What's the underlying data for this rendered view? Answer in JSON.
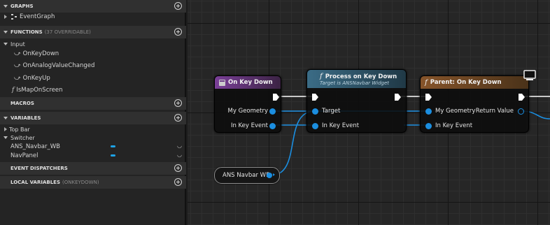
{
  "panel": {
    "graphs": {
      "title": "GRAPHS",
      "items": [
        "EventGraph"
      ]
    },
    "functions": {
      "title": "FUNCTIONS",
      "subtitle": "(37 OVERRIDABLE)",
      "category": "Input",
      "items": [
        "OnKeyDown",
        "OnAnalogValueChanged",
        "OnKeyUp"
      ],
      "extra": "IsMapOnScreen"
    },
    "macros": {
      "title": "MACROS"
    },
    "variables": {
      "title": "VARIABLES",
      "categories": [
        "Top Bar",
        "Switcher"
      ],
      "items": [
        {
          "name": "ANS_Navbar_WB",
          "type_color": "#1ea2e6"
        },
        {
          "name": "NavPanel",
          "type_color": "#1ea2e6"
        }
      ]
    },
    "event_dispatchers": {
      "title": "EVENT DISPATCHERS"
    },
    "local_variables": {
      "title": "LOCAL VARIABLES",
      "subtitle": "(ONKEYDOWN)"
    }
  },
  "graph": {
    "node_on_key_down": {
      "title": "On Key Down",
      "header_color": "#7a3f98",
      "pins": [
        "My Geometry",
        "In Key Event"
      ]
    },
    "node_process": {
      "title": "Process on Key Down",
      "subtitle": "Target is ANSNavbar Widget",
      "header_color": "#3b6c86",
      "pins": [
        "Target",
        "In Key Event"
      ]
    },
    "node_parent": {
      "title": "Parent: On Key Down",
      "header_color": "#86542a",
      "inputs": [
        "My Geometry",
        "In Key Event"
      ],
      "outputs": [
        "Return Value"
      ]
    },
    "var_node": {
      "label": "ANS Navbar WB"
    },
    "colors": {
      "struct_pin": "#1b8ee0",
      "exec": "#ffffff"
    }
  }
}
